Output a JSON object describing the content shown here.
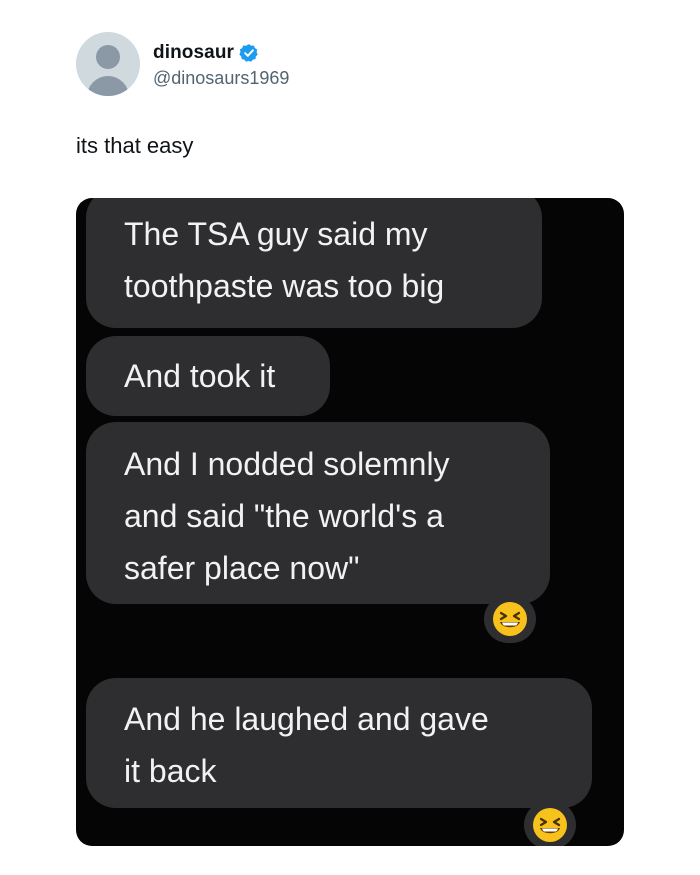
{
  "post": {
    "display_name": "dinosaur",
    "handle": "@dinosaurs1969",
    "verified_icon": "verified-badge-icon",
    "text": "its that easy"
  },
  "media": {
    "messages": [
      {
        "line1": "The TSA guy said my",
        "line2": "toothpaste was too big",
        "line3": ""
      },
      {
        "line1": "And took it",
        "line2": "",
        "line3": ""
      },
      {
        "line1": "And I nodded solemnly",
        "line2": "and said \"the world's a",
        "line3": "safer place now\""
      },
      {
        "line1": "And he laughed and gave",
        "line2": "it back",
        "line3": ""
      }
    ],
    "reactions": [
      "laughing-emoji-icon",
      "laughing-emoji-icon"
    ]
  },
  "colors": {
    "verified": "#1d9bf0",
    "bubble": "#2e2e30",
    "media_background": "#050505",
    "emoji": "#f7c21b"
  }
}
